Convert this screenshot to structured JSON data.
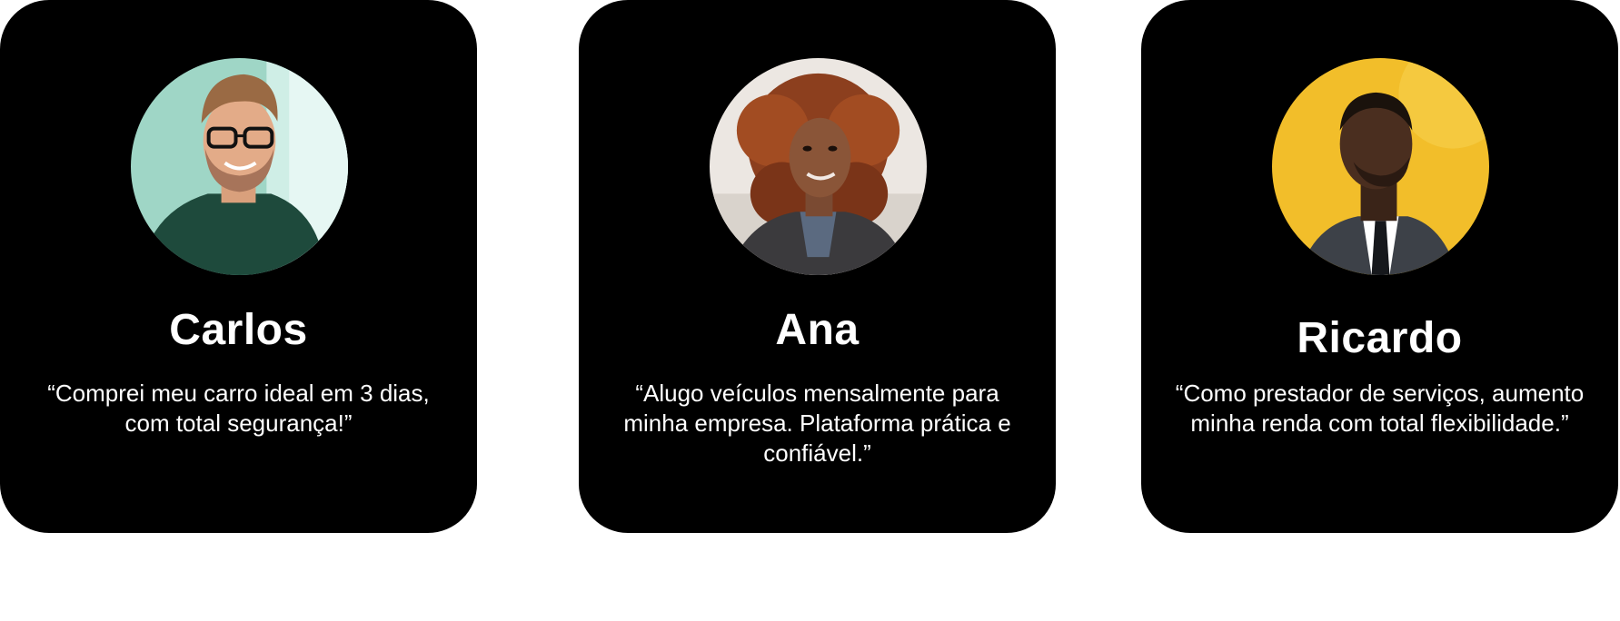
{
  "testimonials": [
    {
      "name": "Carlos",
      "quote": "“Comprei meu carro ideal em 3 dias, com total segurança!”",
      "avatar_bg": "#9fd6c6"
    },
    {
      "name": "Ana",
      "quote": "“Alugo veículos mensalmente para minha empresa. Plataforma prática e confiável.”",
      "avatar_bg": "#e8e4df"
    },
    {
      "name": "Ricardo",
      "quote": "“Como prestador de serviços, aumento minha renda com total flexibilidade.”",
      "avatar_bg": "#f2be2a"
    }
  ]
}
